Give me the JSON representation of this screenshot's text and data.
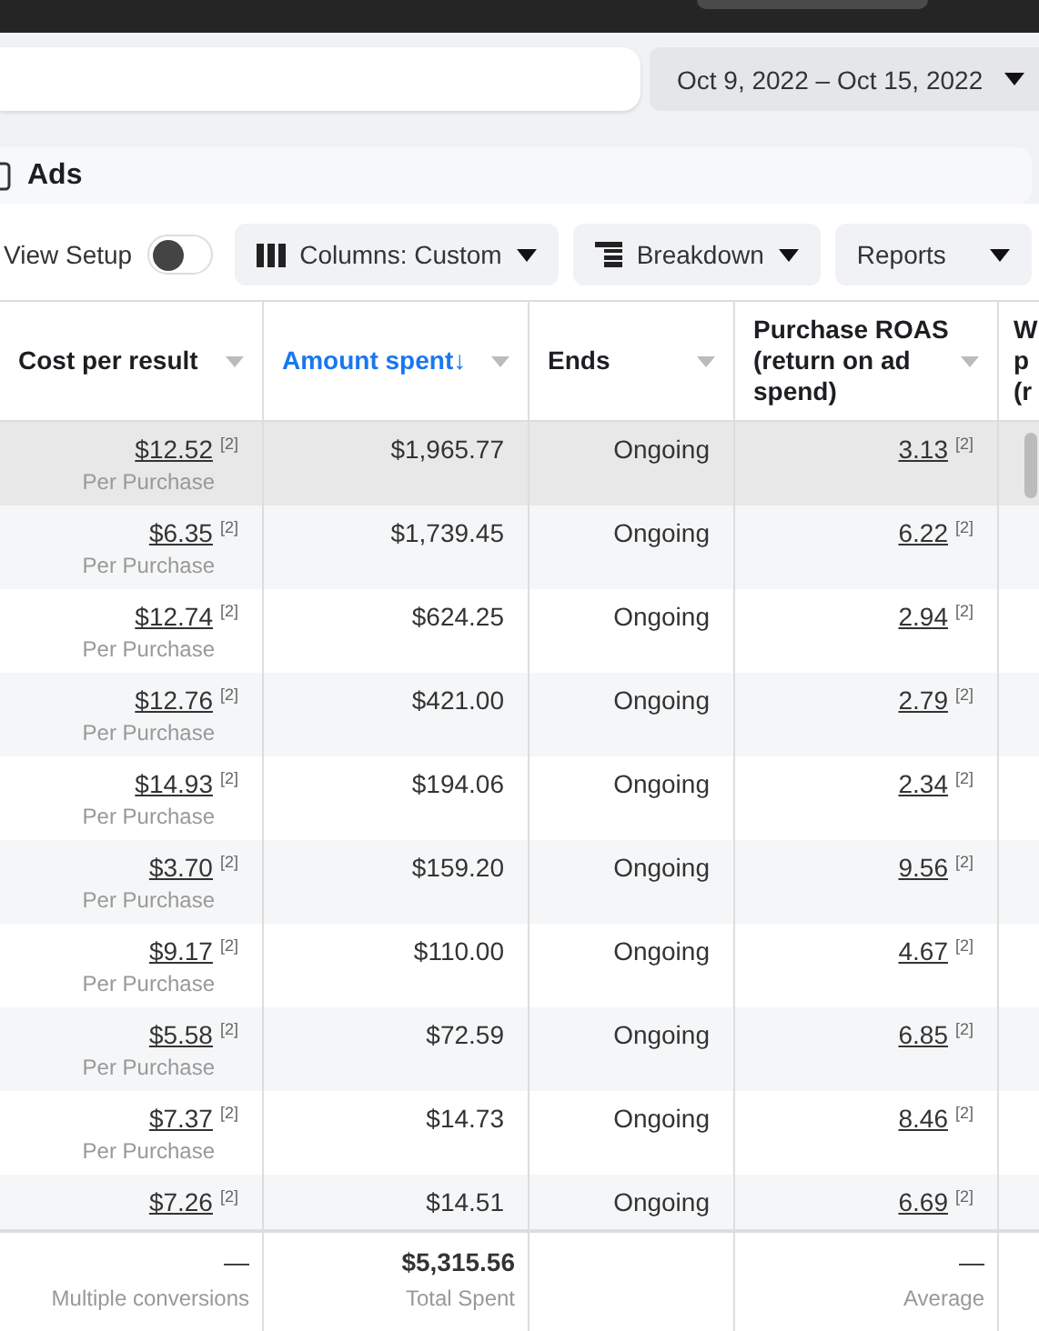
{
  "date_range": "Oct 9, 2022 – Oct 15, 2022",
  "section_title": "Ads",
  "toolbar": {
    "view_setup": {
      "label": "View Setup",
      "on": false
    },
    "buttons": [
      {
        "kind": "columns",
        "label": "Columns: Custom"
      },
      {
        "kind": "breakdown",
        "label": "Breakdown"
      },
      {
        "kind": "reports",
        "label": "Reports"
      }
    ]
  },
  "table": {
    "columns": [
      {
        "label": "Cost per result",
        "sorted": false
      },
      {
        "label": "Amount spent",
        "sorted": true,
        "sort_arrow": "↓"
      },
      {
        "label": "Ends",
        "sorted": false
      },
      {
        "label": "Purchase ROAS (return on ad spend)",
        "sorted": false
      }
    ],
    "column_5_lines": [
      "W",
      "p",
      "(r"
    ],
    "rows": [
      {
        "selected": true,
        "cost": "$12.52",
        "cost_note": "[2]",
        "cost_sub": "Per Purchase",
        "spent": "$1,965.77",
        "ends": "Ongoing",
        "roas": "3.13",
        "roas_note": "[2]"
      },
      {
        "selected": false,
        "cost": "$6.35",
        "cost_note": "[2]",
        "cost_sub": "Per Purchase",
        "spent": "$1,739.45",
        "ends": "Ongoing",
        "roas": "6.22",
        "roas_note": "[2]"
      },
      {
        "selected": false,
        "cost": "$12.74",
        "cost_note": "[2]",
        "cost_sub": "Per Purchase",
        "spent": "$624.25",
        "ends": "Ongoing",
        "roas": "2.94",
        "roas_note": "[2]"
      },
      {
        "selected": false,
        "cost": "$12.76",
        "cost_note": "[2]",
        "cost_sub": "Per Purchase",
        "spent": "$421.00",
        "ends": "Ongoing",
        "roas": "2.79",
        "roas_note": "[2]"
      },
      {
        "selected": false,
        "cost": "$14.93",
        "cost_note": "[2]",
        "cost_sub": "Per Purchase",
        "spent": "$194.06",
        "ends": "Ongoing",
        "roas": "2.34",
        "roas_note": "[2]"
      },
      {
        "selected": false,
        "cost": "$3.70",
        "cost_note": "[2]",
        "cost_sub": "Per Purchase",
        "spent": "$159.20",
        "ends": "Ongoing",
        "roas": "9.56",
        "roas_note": "[2]"
      },
      {
        "selected": false,
        "cost": "$9.17",
        "cost_note": "[2]",
        "cost_sub": "Per Purchase",
        "spent": "$110.00",
        "ends": "Ongoing",
        "roas": "4.67",
        "roas_note": "[2]"
      },
      {
        "selected": false,
        "cost": "$5.58",
        "cost_note": "[2]",
        "cost_sub": "Per Purchase",
        "spent": "$72.59",
        "ends": "Ongoing",
        "roas": "6.85",
        "roas_note": "[2]"
      },
      {
        "selected": false,
        "cost": "$7.37",
        "cost_note": "[2]",
        "cost_sub": "Per Purchase",
        "spent": "$14.73",
        "ends": "Ongoing",
        "roas": "8.46",
        "roas_note": "[2]"
      },
      {
        "selected": false,
        "cost": "$7.26",
        "cost_note": "[2]",
        "spent": "$14.51",
        "ends": "Ongoing",
        "roas": "6.69",
        "roas_note": "[2]"
      }
    ],
    "footer": {
      "cost": {
        "value": "—",
        "caption": "Multiple conversions"
      },
      "spent": {
        "value": "$5,315.56",
        "caption": "Total Spent"
      },
      "roas": {
        "value": "—",
        "caption": "Average"
      }
    }
  }
}
